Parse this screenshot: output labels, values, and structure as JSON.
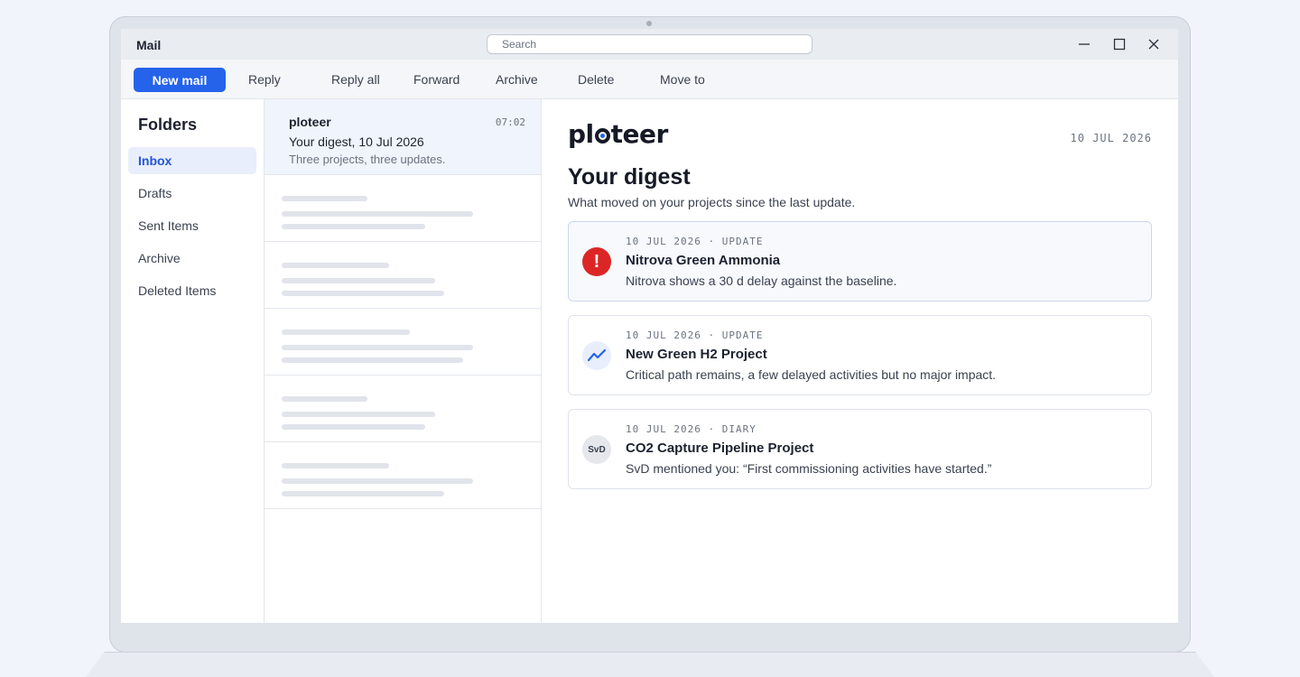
{
  "window": {
    "title": "Mail",
    "search_placeholder": "Search"
  },
  "toolbar": {
    "new_mail": "New mail",
    "reply": "Reply",
    "reply_all": "Reply all",
    "forward": "Forward",
    "archive": "Archive",
    "delete": "Delete",
    "move_to": "Move to"
  },
  "folders": {
    "title": "Folders",
    "items": [
      {
        "label": "Inbox",
        "active": true
      },
      {
        "label": "Drafts"
      },
      {
        "label": "Sent Items"
      },
      {
        "label": "Archive"
      },
      {
        "label": "Deleted Items"
      }
    ]
  },
  "message_list": {
    "selected": {
      "sender": "ploteer",
      "time": "07:02",
      "subject": "Your digest, 10 Jul 2026",
      "preview": "Three projects, three updates."
    }
  },
  "reading": {
    "brand": "ploteer",
    "date": "10 JUL 2026",
    "title": "Your digest",
    "subtitle": "What moved on your projects since the last update.",
    "cards": [
      {
        "meta": "10 JUL 2026 · UPDATE",
        "title": "Nitrova Green Ammonia",
        "text": "Nitrova shows a 30 d delay against the baseline.",
        "icon": "alert-icon"
      },
      {
        "meta": "10 JUL 2026 · UPDATE",
        "title": "New Green H2 Project",
        "text": "Critical path remains, a few delayed activities but no major impact.",
        "icon": "trend-icon"
      },
      {
        "meta": "10 JUL 2026 · DIARY",
        "title": "CO2 Capture Pipeline Project",
        "text": "SvD mentioned you: “First commissioning activities have started.”",
        "icon": "avatar",
        "avatar_initials": "SvD"
      }
    ]
  },
  "colors": {
    "accent": "#2563eb",
    "alert": "#dc2626",
    "active_folder_bg": "#e8eefb"
  }
}
